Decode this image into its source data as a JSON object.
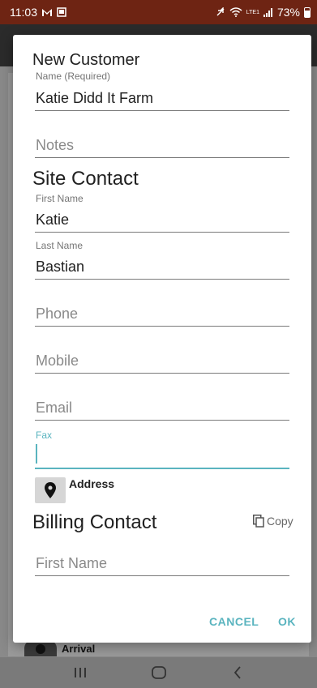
{
  "status_bar": {
    "time": "11:03",
    "battery": "73%",
    "network": "LTE1"
  },
  "background": {
    "arrival_label": "Arrival"
  },
  "dialog": {
    "title": "New Customer",
    "name_field": {
      "label": "Name (Required)",
      "value": "Katie Didd It Farm"
    },
    "notes_field": {
      "placeholder": "Notes"
    },
    "site_contact": {
      "title": "Site Contact",
      "first_name": {
        "label": "First Name",
        "value": "Katie"
      },
      "last_name": {
        "label": "Last Name",
        "value": "Bastian"
      },
      "phone": {
        "placeholder": "Phone"
      },
      "mobile": {
        "placeholder": "Mobile"
      },
      "email": {
        "placeholder": "Email"
      },
      "fax": {
        "label": "Fax",
        "value": ""
      },
      "address_label": "Address"
    },
    "billing_contact": {
      "title": "Billing Contact",
      "copy_label": "Copy",
      "first_name": {
        "placeholder": "First Name"
      }
    },
    "buttons": {
      "cancel": "CANCEL",
      "ok": "OK"
    }
  },
  "colors": {
    "accent": "#5ab4bf",
    "status_bar": "#6e2413"
  }
}
